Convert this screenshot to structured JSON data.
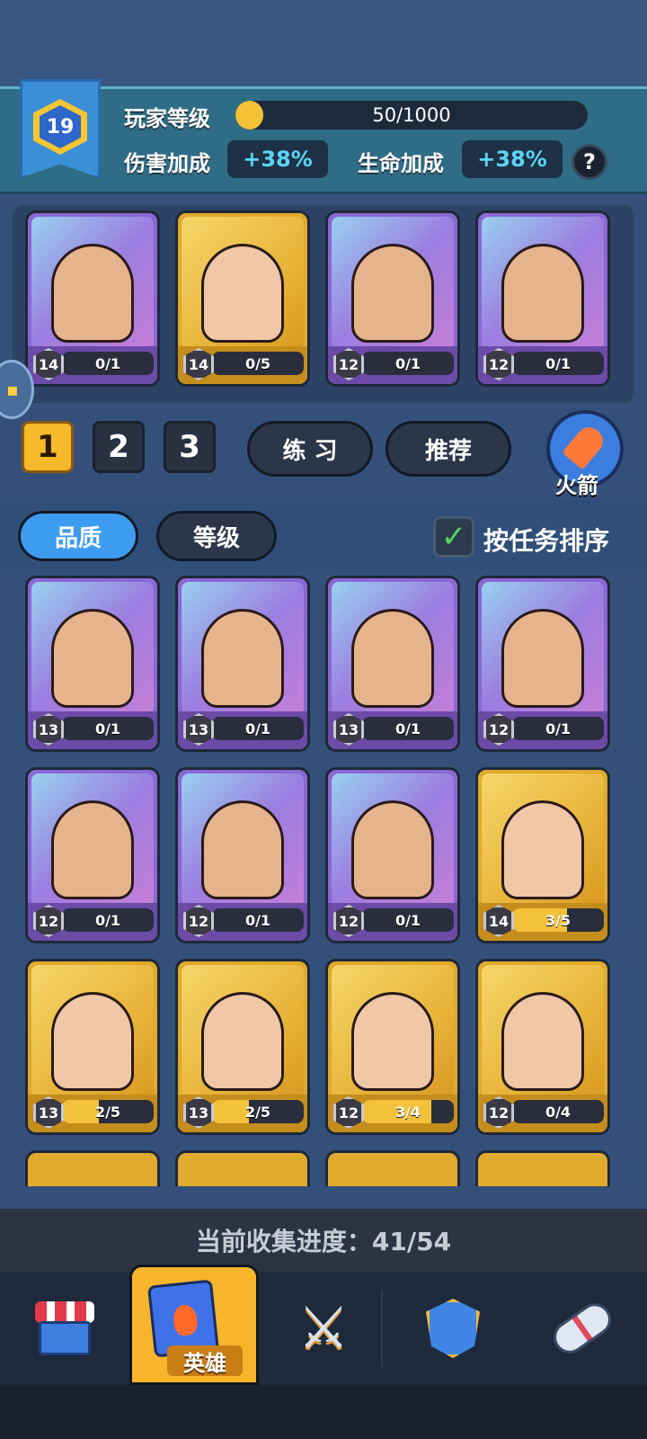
{
  "player": {
    "level": "19",
    "level_label": "玩家等级",
    "xp_text": "50/1000",
    "xp_progress": 0.05,
    "damage_label": "伤害加成",
    "damage_value": "+38%",
    "hp_label": "生命加成",
    "hp_value": "+38%",
    "help_label": "?"
  },
  "team": {
    "heroes": [
      {
        "level": "14",
        "progress": "0/1",
        "rarity": "purple",
        "fill": 0
      },
      {
        "level": "14",
        "progress": "0/5",
        "rarity": "gold",
        "fill": 0
      },
      {
        "level": "12",
        "progress": "0/1",
        "rarity": "purple",
        "fill": 0
      },
      {
        "level": "12",
        "progress": "0/1",
        "rarity": "purple",
        "fill": 0
      }
    ],
    "tabs": [
      "1",
      "2",
      "3"
    ],
    "active_tab": "1",
    "practice_label": "练 习",
    "recommend_label": "推荐",
    "rocket_label": "火箭"
  },
  "sort": {
    "quality_label": "品质",
    "level_label": "等级",
    "task_sort_label": "按任务排序",
    "task_sort_checked": true
  },
  "collection": {
    "heroes": [
      {
        "level": "13",
        "progress": "0/1",
        "rarity": "purple",
        "fill": 0
      },
      {
        "level": "13",
        "progress": "0/1",
        "rarity": "purple",
        "fill": 0
      },
      {
        "level": "13",
        "progress": "0/1",
        "rarity": "purple",
        "fill": 0
      },
      {
        "level": "12",
        "progress": "0/1",
        "rarity": "purple",
        "fill": 0
      },
      {
        "level": "12",
        "progress": "0/1",
        "rarity": "purple",
        "fill": 0
      },
      {
        "level": "12",
        "progress": "0/1",
        "rarity": "purple",
        "fill": 0
      },
      {
        "level": "12",
        "progress": "0/1",
        "rarity": "purple",
        "fill": 0
      },
      {
        "level": "14",
        "progress": "3/5",
        "rarity": "gold",
        "fill": 0.6
      },
      {
        "level": "13",
        "progress": "2/5",
        "rarity": "gold",
        "fill": 0.4
      },
      {
        "level": "13",
        "progress": "2/5",
        "rarity": "gold",
        "fill": 0.4
      },
      {
        "level": "12",
        "progress": "3/4",
        "rarity": "gold",
        "fill": 0.75
      },
      {
        "level": "12",
        "progress": "0/4",
        "rarity": "gold",
        "fill": 0
      }
    ],
    "progress_text": "当前收集进度：41/54"
  },
  "nav": {
    "items": [
      "shop-icon",
      "heroes-icon",
      "battle-icon",
      "clan-icon",
      "events-icon"
    ],
    "active_label": "英雄"
  },
  "colors": {
    "accent_gold": "#f5b92a",
    "accent_blue": "#3d9cf0",
    "bonus_text": "#5ad4f5"
  }
}
